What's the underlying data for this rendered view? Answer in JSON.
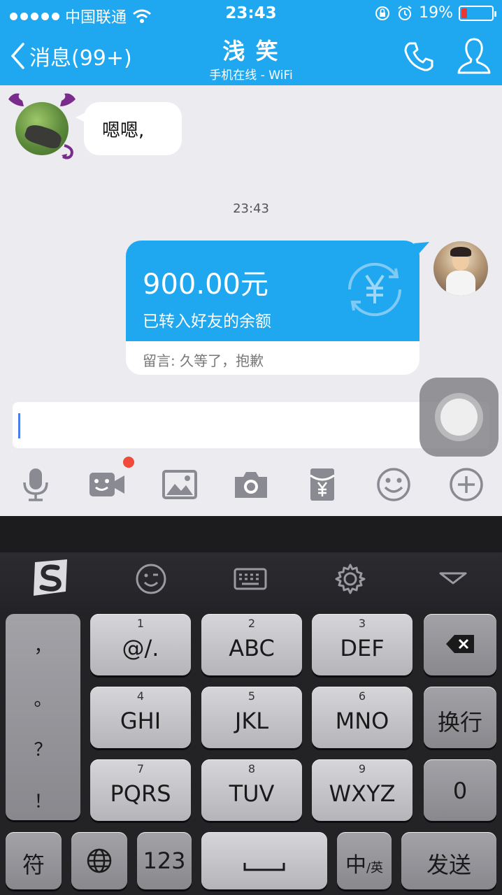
{
  "status_bar": {
    "carrier": "中国联通",
    "time": "23:43",
    "battery": "19%",
    "battery_level": 0.19
  },
  "header": {
    "back_label": "消息(99+)",
    "title": "浅 笑",
    "subtitle": "手机在线 - WiFi"
  },
  "messages": {
    "incoming_text": "嗯嗯,",
    "timestamp": "23:43",
    "transfer": {
      "amount": "900.00元",
      "description": "已转入好友的余额",
      "note": "留言: 久等了，抱歉"
    }
  },
  "toolbar": {
    "icons": [
      "microphone-icon",
      "video-call-icon",
      "image-icon",
      "camera-icon",
      "red-envelope-icon",
      "emoji-icon",
      "plus-icon"
    ]
  },
  "keyboard": {
    "top_icons": [
      "sogou-logo",
      "emoji-icon",
      "keyboard-icon",
      "gear-icon",
      "collapse-icon"
    ],
    "punctuation": [
      "，",
      "。",
      "？",
      "！"
    ],
    "keys": [
      {
        "num": "1",
        "label": "@/."
      },
      {
        "num": "2",
        "label": "ABC"
      },
      {
        "num": "3",
        "label": "DEF"
      },
      {
        "num": "4",
        "label": "GHI"
      },
      {
        "num": "5",
        "label": "JKL"
      },
      {
        "num": "6",
        "label": "MNO"
      },
      {
        "num": "7",
        "label": "PQRS"
      },
      {
        "num": "8",
        "label": "TUV"
      },
      {
        "num": "9",
        "label": "WXYZ"
      }
    ],
    "newline_label": "换行",
    "zero_label": "0",
    "symbol_label": "符",
    "numbers_label": "123",
    "lang_label_main": "中",
    "lang_label_sub": "/英",
    "send_label": "发送"
  }
}
